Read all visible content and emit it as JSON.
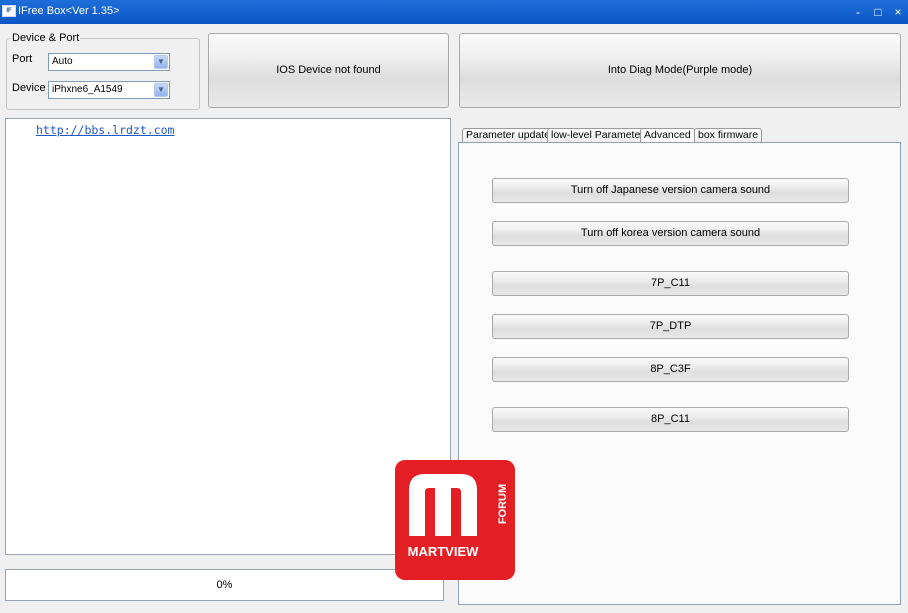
{
  "window": {
    "title": "IFree Box<Ver 1.35>",
    "icon": "app-logo-icon"
  },
  "controls": {
    "minimize": "-",
    "maximize": "□",
    "close": "×"
  },
  "device_port": {
    "legend": "Device & Port",
    "port_label": "Port",
    "port_value": "Auto",
    "device_label": "Device",
    "device_value": "iPhxne6_A1549"
  },
  "status_button": "IOS Device not found",
  "diag_button": "Into Diag Mode(Purple mode)",
  "log": {
    "link": "http://bbs.lrdzt.com"
  },
  "progress": {
    "text": "0%",
    "value": 0
  },
  "tabs": [
    {
      "label": "Parameter update"
    },
    {
      "label": "low-level Parameter"
    },
    {
      "label": "Advanced"
    },
    {
      "label": "box firmware"
    }
  ],
  "active_tab": "Advanced",
  "actions": [
    {
      "label": "Turn off Japanese version camera sound"
    },
    {
      "label": "Turn off korea version camera sound"
    },
    {
      "label": "7P_C11"
    },
    {
      "label": "7P_DTP"
    },
    {
      "label": "8P_C3F"
    },
    {
      "label": "8P_C11"
    }
  ],
  "watermark": {
    "brand": "MARTVIEW",
    "sub": "FORUM",
    "color": "#e31e24"
  }
}
